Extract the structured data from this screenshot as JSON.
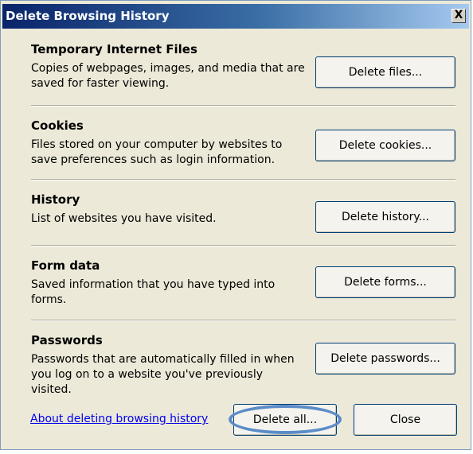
{
  "window": {
    "title": "Delete Browsing History",
    "close_glyph": "X"
  },
  "sections": [
    {
      "title": "Temporary Internet Files",
      "description": "Copies of webpages, images, and media that are saved for faster viewing.",
      "button": "Delete files..."
    },
    {
      "title": "Cookies",
      "description": "Files stored on your computer by websites to save preferences such as login information.",
      "button": "Delete cookies..."
    },
    {
      "title": "History",
      "description": "List of websites you have visited.",
      "button": "Delete history..."
    },
    {
      "title": "Form data",
      "description": "Saved information that you have typed into forms.",
      "button": "Delete forms..."
    },
    {
      "title": "Passwords",
      "description": "Passwords that are automatically filled in when you log on to a website you've previously visited.",
      "button": "Delete passwords..."
    }
  ],
  "footer": {
    "link": "About deleting browsing history",
    "delete_all": "Delete all...",
    "close": "Close"
  },
  "colors": {
    "title_bar_start": "#0a246a",
    "dialog_background": "#ece9d8",
    "highlight_ring": "#5b8cc8",
    "link": "#0000ee"
  },
  "icons": {
    "close": "close-icon"
  }
}
